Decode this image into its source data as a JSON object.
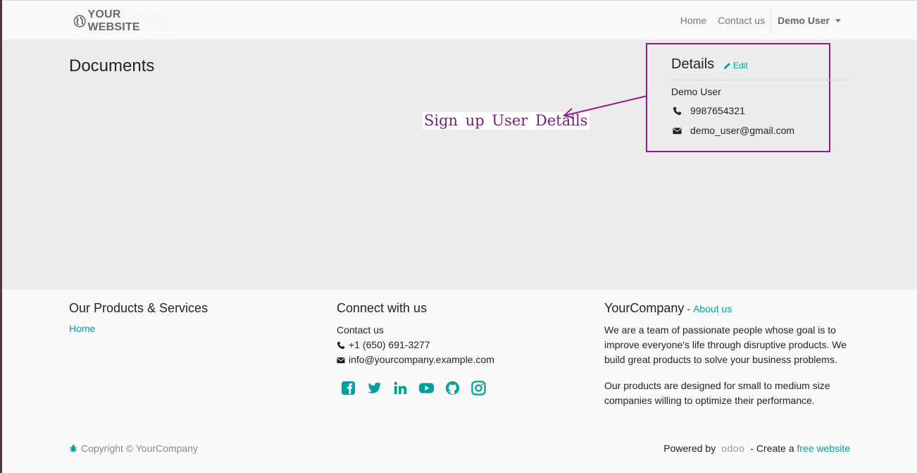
{
  "navbar": {
    "brand": "YOUR WEBSITE",
    "links": [
      "Home",
      "Contact us"
    ],
    "user": "Demo User"
  },
  "main": {
    "title": "Documents",
    "details": {
      "title": "Details",
      "edit_label": "Edit",
      "name": "Demo User",
      "phone": "9987654321",
      "email": "demo_user@gmail.com"
    },
    "annotation": "Sign up User Details"
  },
  "footer": {
    "products": {
      "title": "Our Products & Services",
      "home_link": "Home"
    },
    "connect": {
      "title": "Connect with us",
      "contact_link": "Contact us",
      "phone": "+1 (650) 691-3277",
      "email": "info@yourcompany.example.com",
      "socials": [
        "facebook-icon",
        "twitter-icon",
        "linkedin-icon",
        "youtube-icon",
        "github-icon",
        "instagram-icon"
      ]
    },
    "about": {
      "company": "YourCompany",
      "separator": "-",
      "about_link": "About us",
      "para1": "We are a team of passionate people whose goal is to improve everyone's life through disruptive products. We build great products to solve your business problems.",
      "para2": "Our products are designed for small to medium size companies willing to optimize their performance."
    },
    "copyright": "Copyright © YourCompany",
    "powered_by": "Powered by",
    "odoo": "odoo",
    "create_text": "- Create a",
    "free_website_link": "free website"
  },
  "colors": {
    "accent": "#00a09d",
    "annotation": "#7d1a7d",
    "main_bg": "#ececec",
    "footer_bg": "#f9f9f9"
  }
}
